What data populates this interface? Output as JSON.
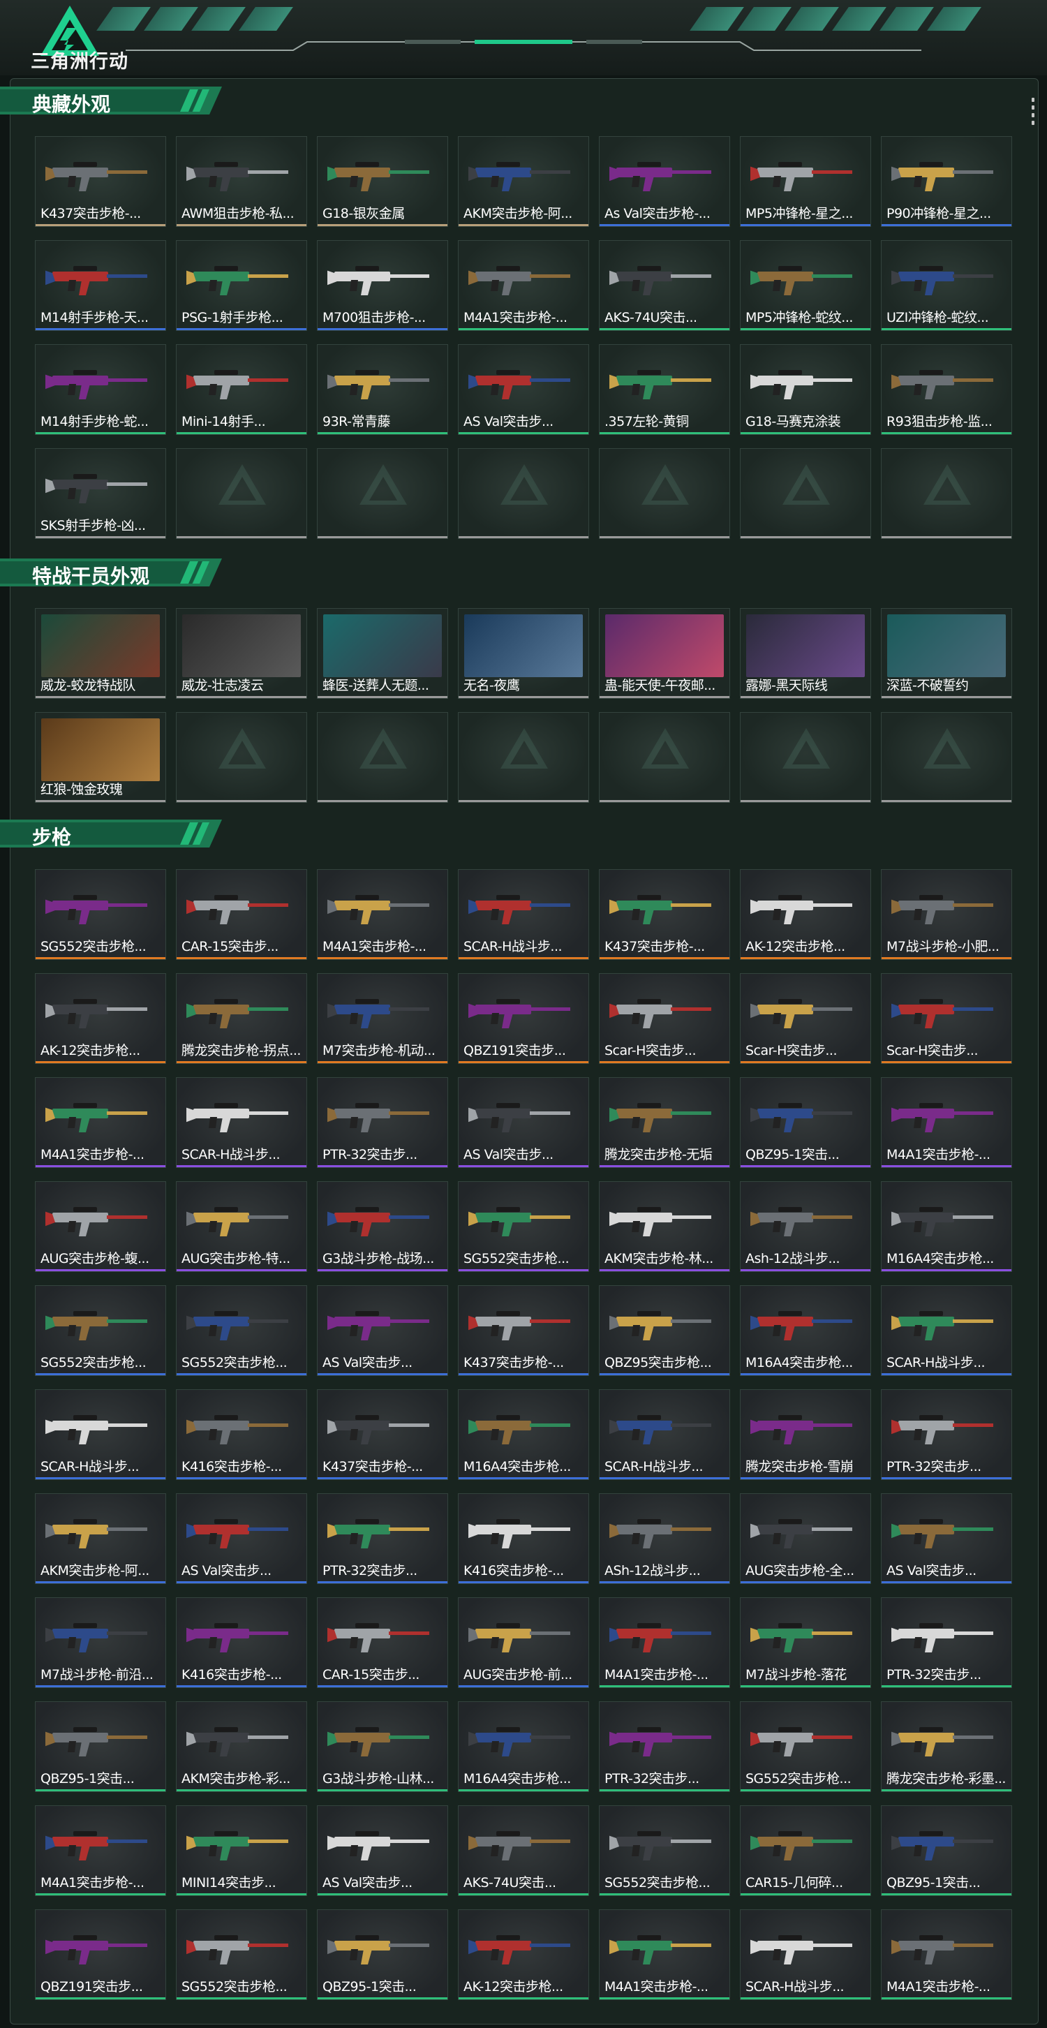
{
  "app": {
    "title": "三角洲行动"
  },
  "colors": {
    "gold": "#b8a07a",
    "blue": "#3d6fd8",
    "green": "#2fbf7a",
    "orange": "#e07a22",
    "purple": "#8a4fe0",
    "gray": "#9a9a9a",
    "accent": "#1fc98a"
  },
  "sections": [
    {
      "title": "典藏外观",
      "items": [
        {
          "label": "K437突击步枪-...",
          "rarity": "gold"
        },
        {
          "label": "AWM狙击步枪-私...",
          "rarity": "gold"
        },
        {
          "label": "G18-银灰金属",
          "rarity": "gold"
        },
        {
          "label": "AKM突击步枪-阿...",
          "rarity": "gold"
        },
        {
          "label": "As Val突击步枪-...",
          "rarity": "blue"
        },
        {
          "label": "MP5冲锋枪-星之...",
          "rarity": "blue"
        },
        {
          "label": "P90冲锋枪-星之...",
          "rarity": "blue"
        },
        {
          "label": "M14射手步枪-天...",
          "rarity": "blue"
        },
        {
          "label": "PSG-1射手步枪...",
          "rarity": "blue"
        },
        {
          "label": "M700狙击步枪-...",
          "rarity": "blue"
        },
        {
          "label": "M4A1突击步枪-...",
          "rarity": "green"
        },
        {
          "label": "AKS-74U突击...",
          "rarity": "green"
        },
        {
          "label": "MP5冲锋枪-蛇纹...",
          "rarity": "green"
        },
        {
          "label": "UZI冲锋枪-蛇纹...",
          "rarity": "green"
        },
        {
          "label": "M14射手步枪-蛇...",
          "rarity": "green"
        },
        {
          "label": "Mini-14射手...",
          "rarity": "green"
        },
        {
          "label": "93R-常青藤",
          "rarity": "green"
        },
        {
          "label": "AS Val突击步...",
          "rarity": "green"
        },
        {
          "label": ".357左轮-黄铜",
          "rarity": "green"
        },
        {
          "label": "G18-马赛克涂装",
          "rarity": "green"
        },
        {
          "label": "R93狙击步枪-监...",
          "rarity": "green"
        },
        {
          "label": "SKS射手步枪-凶...",
          "rarity": "gray"
        }
      ]
    },
    {
      "title": "特战干员外观",
      "items": [
        {
          "label": "威龙-蛟龙特战队",
          "rarity": "gray"
        },
        {
          "label": "威龙-壮志凌云",
          "rarity": "gray"
        },
        {
          "label": "蜂医-送葬人无题...",
          "rarity": "gray"
        },
        {
          "label": "无名-夜鹰",
          "rarity": "gray"
        },
        {
          "label": "蛊-能天使-午夜邮...",
          "rarity": "gray"
        },
        {
          "label": "露娜-黑天际线",
          "rarity": "gray"
        },
        {
          "label": "深蓝-不破誓约",
          "rarity": "gray"
        },
        {
          "label": "红狼-蚀金玫瑰",
          "rarity": "gray"
        }
      ]
    },
    {
      "title": "步枪",
      "items": [
        {
          "label": "SG552突击步枪...",
          "rarity": "orange"
        },
        {
          "label": "CAR-15突击步...",
          "rarity": "orange"
        },
        {
          "label": "M4A1突击步枪-...",
          "rarity": "orange"
        },
        {
          "label": "SCAR-H战斗步...",
          "rarity": "orange"
        },
        {
          "label": "K437突击步枪-...",
          "rarity": "orange"
        },
        {
          "label": "AK-12突击步枪...",
          "rarity": "orange"
        },
        {
          "label": "M7战斗步枪-小肥...",
          "rarity": "orange"
        },
        {
          "label": "AK-12突击步枪...",
          "rarity": "orange"
        },
        {
          "label": "腾龙突击步枪-拐点...",
          "rarity": "orange"
        },
        {
          "label": "M7突击步枪-机动...",
          "rarity": "orange"
        },
        {
          "label": "QBZ191突击步...",
          "rarity": "orange"
        },
        {
          "label": "Scar-H突击步...",
          "rarity": "orange"
        },
        {
          "label": "Scar-H突击步...",
          "rarity": "orange"
        },
        {
          "label": "Scar-H突击步...",
          "rarity": "orange"
        },
        {
          "label": "M4A1突击步枪-...",
          "rarity": "purple"
        },
        {
          "label": "SCAR-H战斗步...",
          "rarity": "purple"
        },
        {
          "label": "PTR-32突击步...",
          "rarity": "purple"
        },
        {
          "label": "AS Val突击步...",
          "rarity": "purple"
        },
        {
          "label": "腾龙突击步枪-无垢",
          "rarity": "purple"
        },
        {
          "label": "QBZ95-1突击...",
          "rarity": "purple"
        },
        {
          "label": "M4A1突击步枪-...",
          "rarity": "purple"
        },
        {
          "label": "AUG突击步枪-蝮...",
          "rarity": "purple"
        },
        {
          "label": "AUG突击步枪-特...",
          "rarity": "purple"
        },
        {
          "label": "G3战斗步枪-战场...",
          "rarity": "purple"
        },
        {
          "label": "SG552突击步枪...",
          "rarity": "purple"
        },
        {
          "label": "AKM突击步枪-林...",
          "rarity": "purple"
        },
        {
          "label": "Ash-12战斗步...",
          "rarity": "purple"
        },
        {
          "label": "M16A4突击步枪...",
          "rarity": "purple"
        },
        {
          "label": "SG552突击步枪...",
          "rarity": "blue"
        },
        {
          "label": "SG552突击步枪...",
          "rarity": "blue"
        },
        {
          "label": "AS Val突击步...",
          "rarity": "blue"
        },
        {
          "label": "K437突击步枪-...",
          "rarity": "blue"
        },
        {
          "label": "QBZ95突击步枪...",
          "rarity": "blue"
        },
        {
          "label": "M16A4突击步枪...",
          "rarity": "blue"
        },
        {
          "label": "SCAR-H战斗步...",
          "rarity": "blue"
        },
        {
          "label": "SCAR-H战斗步...",
          "rarity": "blue"
        },
        {
          "label": "K416突击步枪-...",
          "rarity": "blue"
        },
        {
          "label": "K437突击步枪-...",
          "rarity": "blue"
        },
        {
          "label": "M16A4突击步枪...",
          "rarity": "blue"
        },
        {
          "label": "SCAR-H战斗步...",
          "rarity": "blue"
        },
        {
          "label": "腾龙突击步枪-雪崩",
          "rarity": "blue"
        },
        {
          "label": "PTR-32突击步...",
          "rarity": "blue"
        },
        {
          "label": "AKM突击步枪-阿...",
          "rarity": "blue"
        },
        {
          "label": "AS Val突击步...",
          "rarity": "blue"
        },
        {
          "label": "PTR-32突击步...",
          "rarity": "blue"
        },
        {
          "label": "K416突击步枪-...",
          "rarity": "blue"
        },
        {
          "label": "ASh-12战斗步...",
          "rarity": "blue"
        },
        {
          "label": "AUG突击步枪-全...",
          "rarity": "blue"
        },
        {
          "label": "AS Val突击步...",
          "rarity": "blue"
        },
        {
          "label": "M7战斗步枪-前沿...",
          "rarity": "blue"
        },
        {
          "label": "K416突击步枪-...",
          "rarity": "blue"
        },
        {
          "label": "CAR-15突击步...",
          "rarity": "blue"
        },
        {
          "label": "AUG突击步枪-前...",
          "rarity": "blue"
        },
        {
          "label": "M4A1突击步枪-...",
          "rarity": "green"
        },
        {
          "label": "M7战斗步枪-落花",
          "rarity": "green"
        },
        {
          "label": "PTR-32突击步...",
          "rarity": "green"
        },
        {
          "label": "QBZ95-1突击...",
          "rarity": "green"
        },
        {
          "label": "AKM突击步枪-彩...",
          "rarity": "green"
        },
        {
          "label": "G3战斗步枪-山林...",
          "rarity": "green"
        },
        {
          "label": "M16A4突击步枪...",
          "rarity": "green"
        },
        {
          "label": "PTR-32突击步...",
          "rarity": "green"
        },
        {
          "label": "SG552突击步枪...",
          "rarity": "green"
        },
        {
          "label": "腾龙突击步枪-彩墨...",
          "rarity": "green"
        },
        {
          "label": "M4A1突击步枪-...",
          "rarity": "green"
        },
        {
          "label": "MINI14突击步...",
          "rarity": "green"
        },
        {
          "label": "AS Val突击步...",
          "rarity": "green"
        },
        {
          "label": "AKS-74U突击...",
          "rarity": "green"
        },
        {
          "label": "SG552突击步枪...",
          "rarity": "green"
        },
        {
          "label": "CAR15-几何碎...",
          "rarity": "green"
        },
        {
          "label": "QBZ95-1突击...",
          "rarity": "green"
        },
        {
          "label": "QBZ191突击步...",
          "rarity": "green"
        },
        {
          "label": "SG552突击步枪...",
          "rarity": "green"
        },
        {
          "label": "QBZ95-1突击...",
          "rarity": "green"
        },
        {
          "label": "AK-12突击步枪...",
          "rarity": "green"
        },
        {
          "label": "M4A1突击步枪-...",
          "rarity": "green"
        },
        {
          "label": "SCAR-H战斗步...",
          "rarity": "green"
        },
        {
          "label": "M4A1突击步枪-...",
          "rarity": "green"
        }
      ]
    }
  ]
}
